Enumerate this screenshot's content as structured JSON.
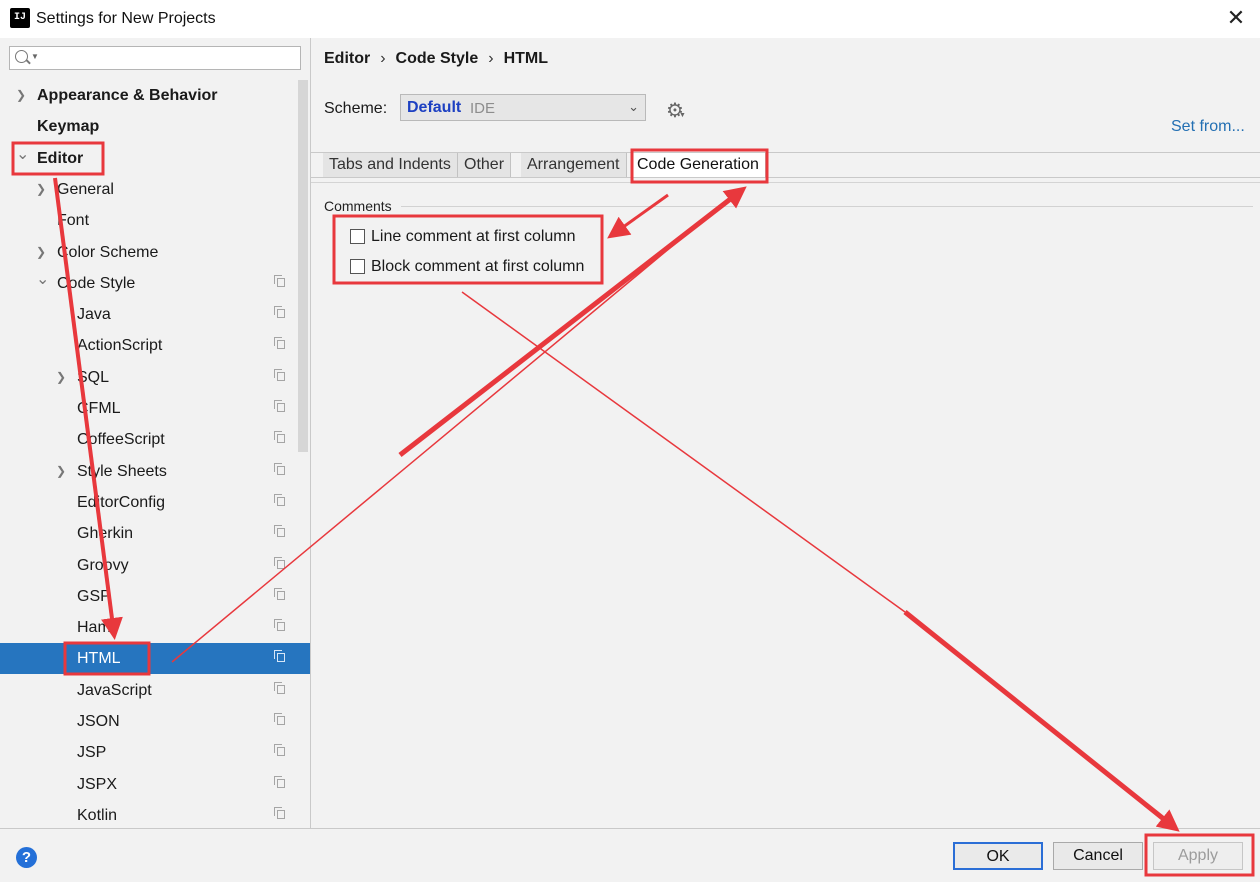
{
  "window": {
    "title": "Settings for New Projects",
    "app_icon_text": "IJ"
  },
  "sidebar": {
    "search_placeholder": "",
    "items": [
      {
        "label": "Appearance & Behavior",
        "level": 0,
        "bold": true,
        "arrow": "›"
      },
      {
        "label": "Keymap",
        "level": 0,
        "bold": true,
        "arrow": ""
      },
      {
        "label": "Editor",
        "level": 0,
        "bold": true,
        "arrow": "⌄"
      },
      {
        "label": "General",
        "level": 1,
        "arrow": "›"
      },
      {
        "label": "Font",
        "level": 1,
        "arrow": ""
      },
      {
        "label": "Color Scheme",
        "level": 1,
        "arrow": "›"
      },
      {
        "label": "Code Style",
        "level": 1,
        "arrow": "⌄",
        "copy": true
      },
      {
        "label": "Java",
        "level": 2,
        "copy": true
      },
      {
        "label": "ActionScript",
        "level": 2,
        "copy": true
      },
      {
        "label": "SQL",
        "level": 2,
        "arrow": "›",
        "copy": true
      },
      {
        "label": "CFML",
        "level": 2,
        "copy": true
      },
      {
        "label": "CoffeeScript",
        "level": 2,
        "copy": true
      },
      {
        "label": "Style Sheets",
        "level": 2,
        "arrow": "›",
        "copy": true
      },
      {
        "label": "EditorConfig",
        "level": 2,
        "copy": true
      },
      {
        "label": "Gherkin",
        "level": 2,
        "copy": true
      },
      {
        "label": "Groovy",
        "level": 2,
        "copy": true
      },
      {
        "label": "GSP",
        "level": 2,
        "copy": true
      },
      {
        "label": "Haml",
        "level": 2,
        "copy": true
      },
      {
        "label": "HTML",
        "level": 2,
        "copy": true,
        "selected": true
      },
      {
        "label": "JavaScript",
        "level": 2,
        "copy": true
      },
      {
        "label": "JSON",
        "level": 2,
        "copy": true
      },
      {
        "label": "JSP",
        "level": 2,
        "copy": true
      },
      {
        "label": "JSPX",
        "level": 2,
        "copy": true
      },
      {
        "label": "Kotlin",
        "level": 2,
        "copy": true
      }
    ]
  },
  "main": {
    "breadcrumb": [
      "Editor",
      "Code Style",
      "HTML"
    ],
    "breadcrumb_sep": "›",
    "scheme_label": "Scheme:",
    "scheme_name": "Default",
    "scheme_type": "IDE",
    "set_from": "Set from...",
    "tabs": [
      "Tabs and Indents",
      "Other",
      "Arrangement",
      "Code Generation"
    ],
    "active_tab": "Code Generation",
    "section_title": "Comments",
    "checkboxes": [
      {
        "label": "Line comment at first column",
        "checked": false
      },
      {
        "label": "Block comment at first column",
        "checked": false
      }
    ]
  },
  "footer": {
    "help": "?",
    "ok": "OK",
    "cancel": "Cancel",
    "apply": "Apply"
  },
  "colors": {
    "selection": "#2675bf",
    "annotation": "#e8383d",
    "link": "#2470b3",
    "scheme_name": "#1d40c2"
  }
}
